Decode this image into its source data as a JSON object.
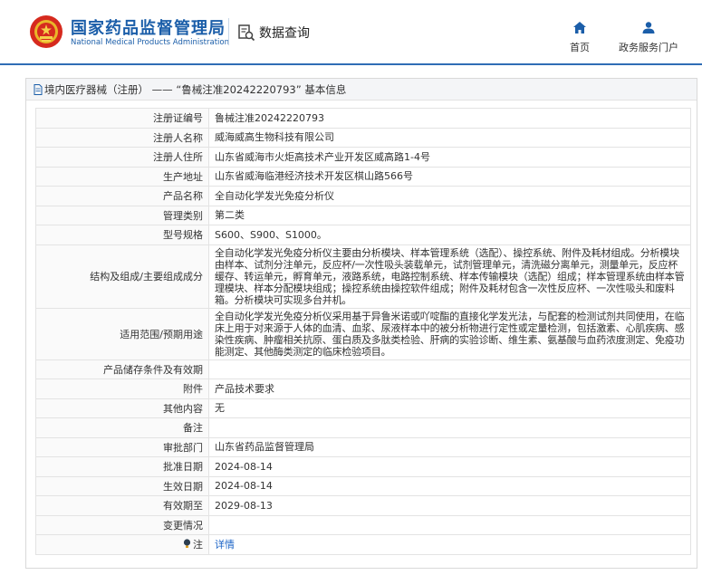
{
  "header": {
    "brand_cn": "国家药品监督管理局",
    "brand_en": "National Medical Products Administration",
    "db_query": "数据查询",
    "nav_home": "首页",
    "nav_portal": "政务服务门户",
    "colors": {
      "brand": "#1b5ea9",
      "accent": "#2f6db5",
      "link": "#1a63c6"
    }
  },
  "breadcrumb": {
    "category": "境内医疗器械（注册）",
    "separator": "——",
    "record": "“鲁械注准20242220793” 基本信息"
  },
  "rows": [
    {
      "key": "注册证编号",
      "value": "鲁械注准20242220793"
    },
    {
      "key": "注册人名称",
      "value": "威海威高生物科技有限公司"
    },
    {
      "key": "注册人住所",
      "value": "山东省威海市火炬高技术产业开发区威高路1-4号"
    },
    {
      "key": "生产地址",
      "value": "山东省威海临港经济技术开发区棋山路566号"
    },
    {
      "key": "产品名称",
      "value": "全自动化学发光免疫分析仪"
    },
    {
      "key": "管理类别",
      "value": "第二类"
    },
    {
      "key": "型号规格",
      "value": "S600、S900、S1000。"
    },
    {
      "key": "结构及组成/主要组成成分",
      "value": "全自动化学发光免疫分析仪主要由分析模块、样本管理系统（选配）、操控系统、附件及耗材组成。分析模块由样本、试剂分注单元，反应杯/一次性吸头装载单元，试剂管理单元，清洗磁分离单元，测量单元，反应杯缓存、转运单元，孵育单元，液路系统，电路控制系统、样本传输模块（选配）组成；样本管理系统由样本管理模块、样本分配模块组成；操控系统由操控软件组成；附件及耗材包含一次性反应杯、一次性吸头和废料箱。分析模块可实现多台并机。"
    },
    {
      "key": "适用范围/预期用途",
      "value": "全自动化学发光免疫分析仪采用基于异鲁米诺或吖啶酯的直接化学发光法，与配套的检测试剂共同使用，在临床上用于对来源于人体的血清、血浆、尿液样本中的被分析物进行定性或定量检测，包括激素、心肌疾病、感染性疾病、肿瘤相关抗原、蛋白质及多肽类检验、肝病的实验诊断、维生素、氨基酸与血药浓度测定、免疫功能测定、其他酶类测定的临床检验项目。"
    },
    {
      "key": "产品储存条件及有效期",
      "value": ""
    },
    {
      "key": "附件",
      "value": "产品技术要求"
    },
    {
      "key": "其他内容",
      "value": "无"
    },
    {
      "key": "备注",
      "value": ""
    },
    {
      "key": "审批部门",
      "value": "山东省药品监督管理局"
    },
    {
      "key": "批准日期",
      "value": "2024-08-14"
    },
    {
      "key": "生效日期",
      "value": "2024-08-14"
    },
    {
      "key": "有效期至",
      "value": "2029-08-13"
    },
    {
      "key": "变更情况",
      "value": ""
    },
    {
      "key": "注",
      "value": "详情"
    }
  ]
}
